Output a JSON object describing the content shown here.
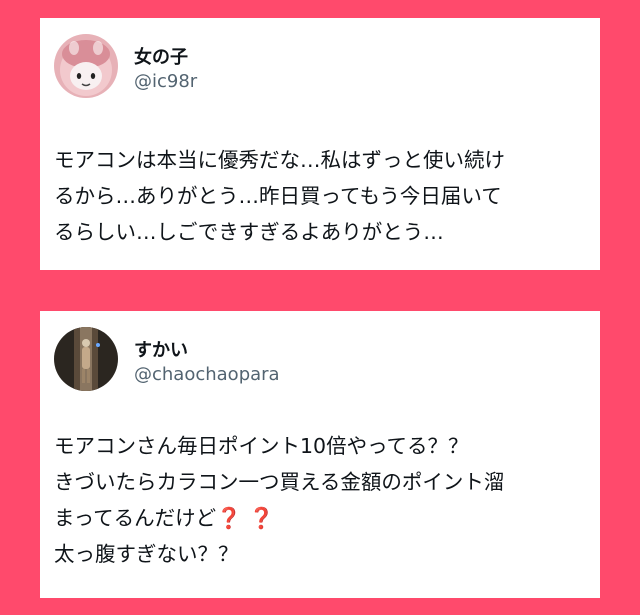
{
  "posts": [
    {
      "user": {
        "name": "女の子",
        "handle": "@ic98r",
        "avatar_icon": "pink-character-avatar-icon"
      },
      "text_lines": [
        "モアコンは本当に優秀だな…私はずっと使い続け",
        "るから…ありがとう…昨日買ってもう今日届いて",
        "るらしい…しごできすぎるよありがとう…"
      ]
    },
    {
      "user": {
        "name": "すかい",
        "handle": "@chaochaopara",
        "avatar_icon": "dark-photo-avatar-icon"
      },
      "text_lines": [
        "モアコンさん毎日ポイント10倍やってる？？",
        "きづいたらカラコン一つ買える金額のポイント溜",
        "まってるんだけど",
        "太っ腹すぎない？？"
      ],
      "emoji_marks": "❓ ❓"
    }
  ],
  "colors": {
    "background": "#ff4a6c",
    "card": "#ffffff",
    "handle": "#536471",
    "emoji_question": "#c0142b"
  }
}
